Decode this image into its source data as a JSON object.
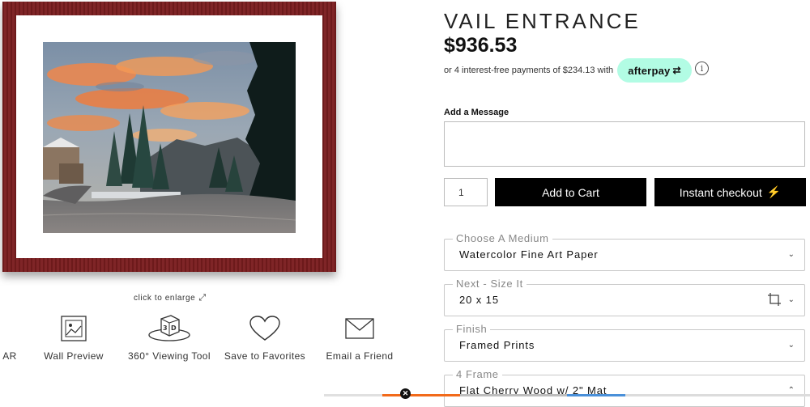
{
  "product": {
    "title": "VAIL ENTRANCE",
    "price": "$936.53"
  },
  "afterpay": {
    "installment_text": "or 4 interest-free payments of $234.13 with",
    "brand_label": "afterpay",
    "brand_color": "#b2fce4"
  },
  "gallery": {
    "enlarge_label": "click to enlarge",
    "frame_color": "#7a1d1f"
  },
  "tools": [
    {
      "label": "AR",
      "icon": "ar-icon"
    },
    {
      "label": "Wall Preview",
      "icon": "wall-preview-icon"
    },
    {
      "label": "360° Viewing Tool",
      "icon": "3d-viewer-icon"
    },
    {
      "label": "Save to Favorites",
      "icon": "heart-icon"
    },
    {
      "label": "Email a Friend",
      "icon": "envelope-icon"
    }
  ],
  "message": {
    "label": "Add a Message",
    "value": ""
  },
  "cart": {
    "quantity": "1",
    "add_to_cart_label": "Add to Cart",
    "instant_checkout_label": "Instant checkout"
  },
  "options": [
    {
      "legend": "Choose A Medium",
      "value": "Watercolor Fine Art Paper"
    },
    {
      "legend": "Next - Size It",
      "value": "20 x 15"
    },
    {
      "legend": "Finish",
      "value": "Framed Prints"
    },
    {
      "legend": "4 Frame",
      "value": "Flat Cherry Wood w/ 2\" Mat"
    }
  ]
}
